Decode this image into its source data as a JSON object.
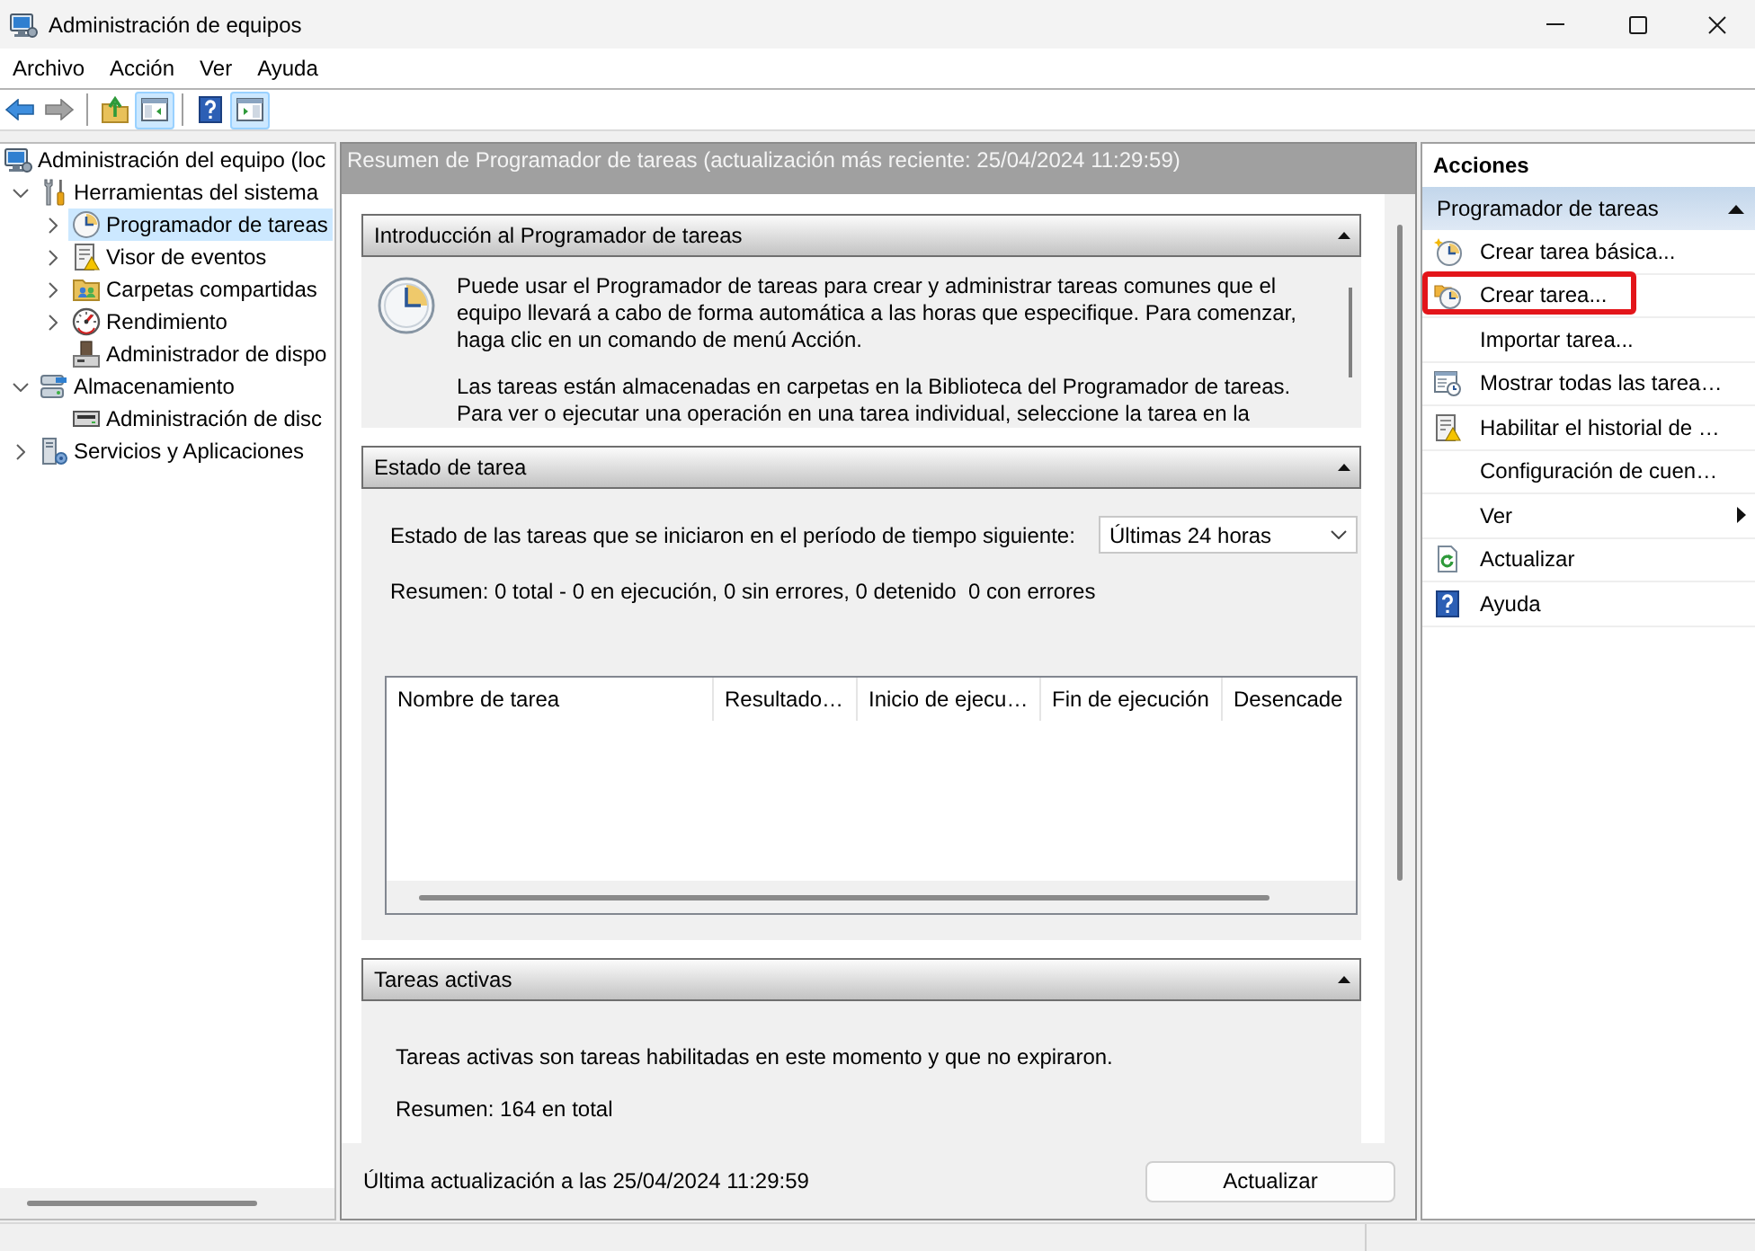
{
  "window": {
    "title": "Administración de equipos"
  },
  "menu": [
    "Archivo",
    "Acción",
    "Ver",
    "Ayuda"
  ],
  "toolbar": {
    "groups": [
      [
        {
          "kind": "back",
          "disabled": false,
          "pressed": false
        },
        {
          "kind": "forward",
          "disabled": true,
          "pressed": false
        }
      ],
      [
        {
          "kind": "up",
          "disabled": false,
          "pressed": false
        },
        {
          "kind": "console-tree",
          "disabled": false,
          "pressed": true
        }
      ],
      [
        {
          "kind": "help",
          "disabled": false,
          "pressed": false
        },
        {
          "kind": "action-pane",
          "disabled": false,
          "pressed": true
        }
      ]
    ]
  },
  "tree": [
    {
      "label": "Administración del equipo (loc",
      "selected": false,
      "children": [
        {
          "label": "Herramientas del sistema",
          "selected": false,
          "expanded": true,
          "children": [
            {
              "label": "Programador de tareas",
              "selected": true,
              "expanded": false
            },
            {
              "label": "Visor de eventos",
              "selected": false,
              "expanded": false
            },
            {
              "label": "Carpetas compartidas",
              "selected": false,
              "expanded": false
            },
            {
              "label": "Rendimiento",
              "selected": false,
              "expanded": false
            },
            {
              "label": "Administrador de dispo",
              "selected": false
            }
          ]
        },
        {
          "label": "Almacenamiento",
          "selected": false,
          "expanded": true,
          "children": [
            {
              "label": "Administración de disc",
              "selected": false
            }
          ]
        },
        {
          "label": "Servicios y Aplicaciones",
          "selected": false,
          "expanded": false
        }
      ]
    }
  ],
  "summary": {
    "title": "Resumen de Programador de tareas (actualización más reciente: 25/04/2024 11:29:59)",
    "sections": [
      {
        "kind": "intro",
        "title": "Introducción al Programador de tareas",
        "expanded": true,
        "paragraphs": [
          "Puede usar el Programador de tareas para crear y administrar tareas comunes que el equipo llevará a cabo de forma automática a las horas que especifique. Para comenzar, haga clic en un comando de menú Acción.",
          "Las tareas están almacenadas en carpetas en la Biblioteca del Programador de tareas. Para ver o ejecutar una operación en una tarea individual, seleccione la tarea en la"
        ]
      },
      {
        "kind": "status",
        "title": "Estado de tarea",
        "expanded": true,
        "period_label": "Estado de las tareas que se iniciaron en el período de tiempo siguiente:",
        "period_dropdown": {
          "value": "Últimas 24 horas"
        },
        "summary": "Resumen: 0 total - 0 en ejecución, 0 sin errores, 0 detenido  0 con errores",
        "table": {
          "columns": [
            "Nombre de tarea",
            "Resultado…",
            "Inicio de ejecu…",
            "Fin de ejecución",
            "Desencade"
          ]
        }
      },
      {
        "kind": "active",
        "title": "Tareas activas",
        "expanded": true,
        "description": "Tareas activas son tareas habilitadas en este momento y que no expiraron.",
        "summary": "Resumen: 164 en total"
      }
    ],
    "footer": {
      "text": "Última actualización a las 25/04/2024 11:29:59",
      "button": "Actualizar"
    }
  },
  "actions": {
    "title": "Acciones",
    "section": {
      "title": "Programador de tareas",
      "expanded": true
    },
    "items": [
      {
        "label": "Crear tarea básica...",
        "highlighted": false,
        "submenu": false
      },
      {
        "label": "Crear tarea...",
        "highlighted": true,
        "submenu": false
      },
      {
        "label": "Importar tarea...",
        "highlighted": false,
        "submenu": false
      },
      {
        "label": "Mostrar todas las tarea…",
        "highlighted": false,
        "submenu": false
      },
      {
        "label": "Habilitar el historial de …",
        "highlighted": false,
        "submenu": false
      },
      {
        "label": "Configuración de cuen…",
        "highlighted": false,
        "submenu": false
      },
      {
        "label": "Ver",
        "highlighted": false,
        "submenu": true
      },
      {
        "label": "Actualizar",
        "highlighted": false,
        "submenu": false
      },
      {
        "label": "Ayuda",
        "highlighted": false,
        "submenu": false
      }
    ]
  }
}
